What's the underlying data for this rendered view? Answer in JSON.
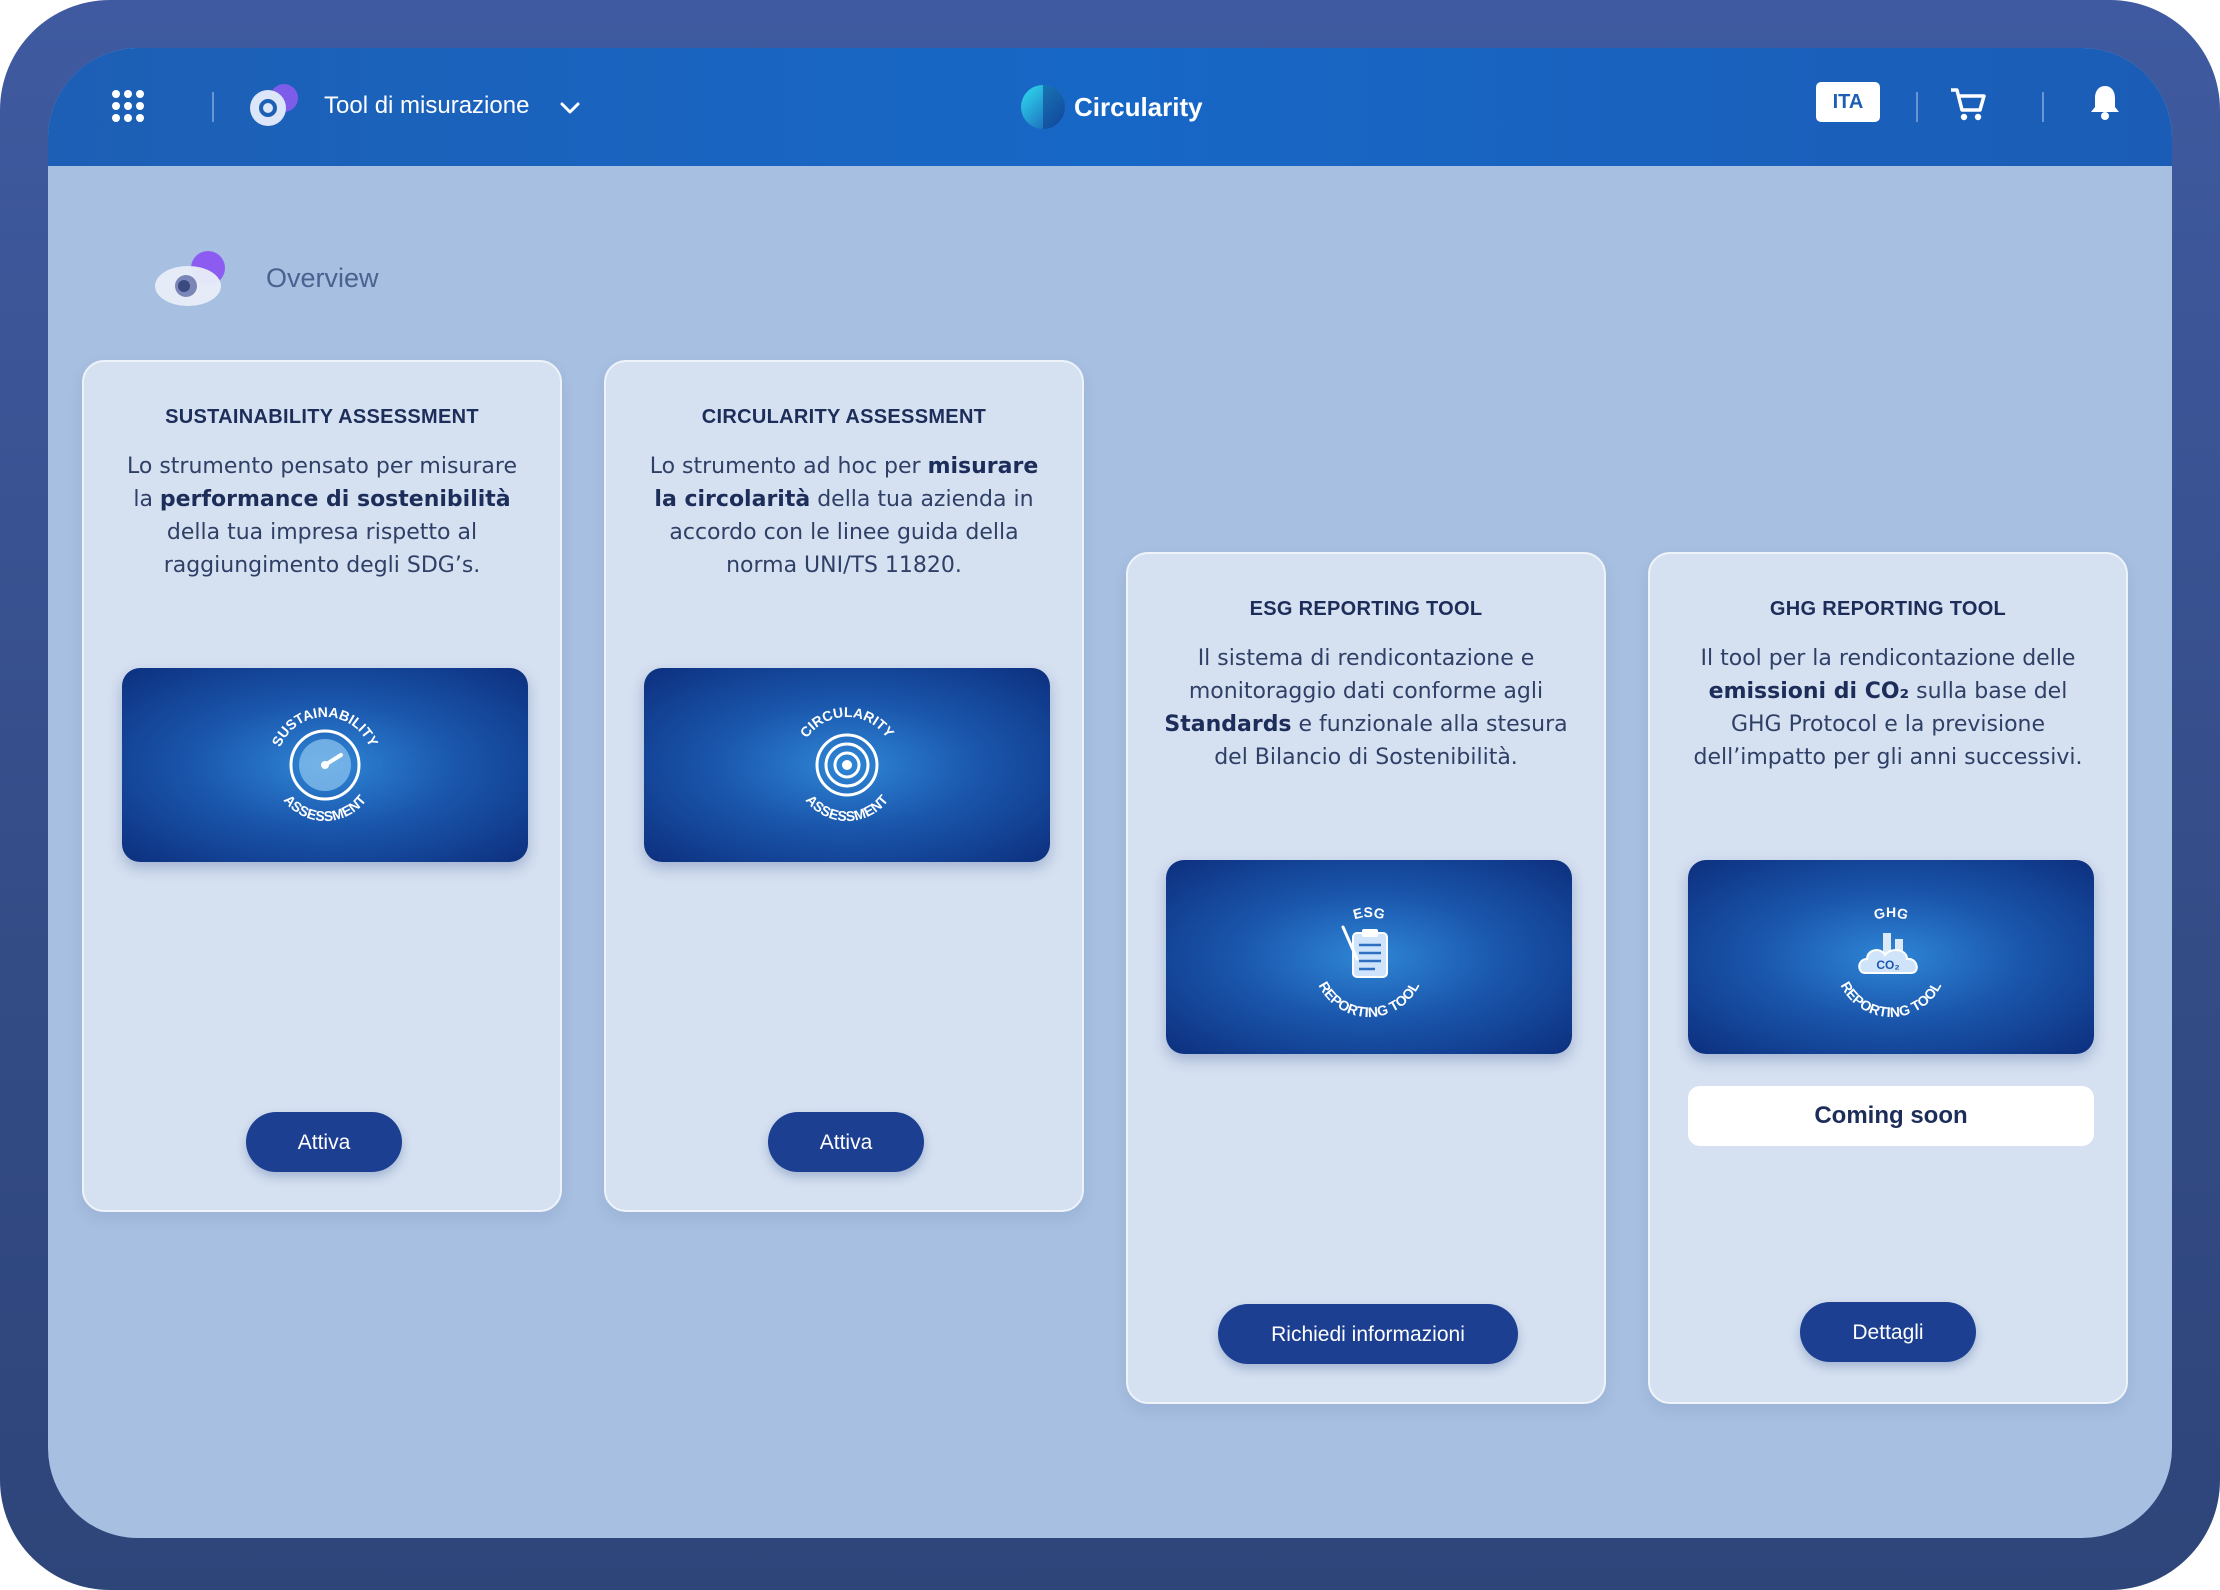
{
  "colors": {
    "topbar": "#1767c6",
    "primary_button": "#1c3f92",
    "background": "#a7bfe0",
    "card": "#d5e1f1"
  },
  "header": {
    "apps_icon": "grid-dots-icon",
    "tool_selector": {
      "icon": "tool-gear-icon",
      "label": "Tool di misurazione",
      "chevron_icon": "chevron-down-icon"
    },
    "brand": {
      "logo_icon": "circularity-logo-icon",
      "name": "Circularity"
    },
    "language": "ITA",
    "cart_icon": "cart-icon",
    "notifications_icon": "bell-icon"
  },
  "page": {
    "title": "Overview",
    "title_icon": "eye-icon"
  },
  "cards": [
    {
      "title": "SUSTAINABILITY ASSESSMENT",
      "desc": [
        "Lo strumento pensato per misurare la ",
        "performance di sostenibilità",
        " della tua impresa rispetto al raggiungimento degli SDG’s."
      ],
      "image": {
        "icon": "gauge-icon",
        "top_text": "SUSTAINABILITY",
        "bottom_text": "ASSESSMENT"
      },
      "button": "Attiva"
    },
    {
      "title": "CIRCULARITY ASSESSMENT",
      "desc": [
        "Lo strumento ad hoc per ",
        "misurare la circolarità",
        " della tua azienda in accordo con le linee guida della norma UNI/TS 11820."
      ],
      "image": {
        "icon": "circular-target-icon",
        "top_text": "CIRCULARITY",
        "bottom_text": "ASSESSMENT"
      },
      "button": "Attiva"
    },
    {
      "title": "ESG REPORTING TOOL",
      "desc": [
        "Il sistema di rendicontazione e monitoraggio dati conforme agli ",
        "Standards",
        " e funzionale alla stesura del Bilancio di Sostenibilità."
      ],
      "image": {
        "icon": "clipboard-icon",
        "top_text": "ESG",
        "bottom_text": "REPORTING TOOL"
      },
      "button": "Richiedi informazioni"
    },
    {
      "title": "GHG REPORTING TOOL",
      "desc": [
        "Il tool per la rendicontazione delle ",
        "emissioni di CO₂",
        " sulla base del GHG Protocol e la previsione dell’impatto per gli anni successivi."
      ],
      "image": {
        "icon": "co2-cloud-icon",
        "top_text": "GHG",
        "bottom_text": "REPORTING TOOL",
        "inner_text": "CO₂"
      },
      "badge": "Coming soon",
      "button": "Dettagli"
    }
  ]
}
